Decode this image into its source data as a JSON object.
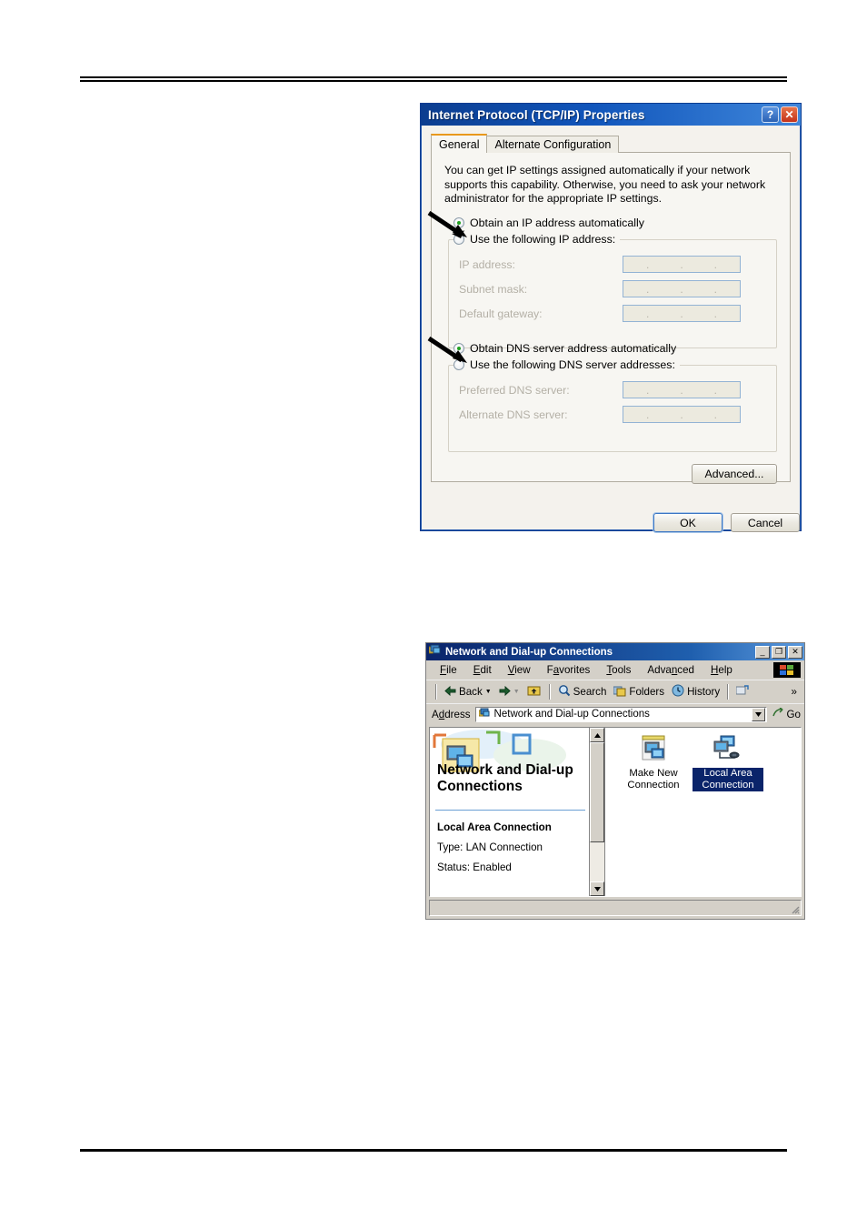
{
  "dialog": {
    "title": "Internet Protocol (TCP/IP) Properties",
    "help_button": "?",
    "close_button": "✕",
    "tabs": [
      {
        "label": "General",
        "active": true
      },
      {
        "label": "Alternate Configuration",
        "active": false
      }
    ],
    "intro": "You can get IP settings assigned automatically if your network supports this capability. Otherwise, you need to ask your network administrator for the appropriate IP settings.",
    "ip_section": {
      "auto_radio_label": "Obtain an IP address automatically",
      "auto_radio_checked": true,
      "manual_radio_label": "Use the following IP address:",
      "manual_radio_checked": false,
      "fields": [
        {
          "label": "IP address:",
          "value": ""
        },
        {
          "label": "Subnet mask:",
          "value": ""
        },
        {
          "label": "Default gateway:",
          "value": ""
        }
      ]
    },
    "dns_section": {
      "auto_radio_label": "Obtain DNS server address automatically",
      "auto_radio_checked": true,
      "manual_radio_label": "Use the following DNS server addresses:",
      "manual_radio_checked": false,
      "fields": [
        {
          "label": "Preferred DNS server:",
          "value": ""
        },
        {
          "label": "Alternate DNS server:",
          "value": ""
        }
      ]
    },
    "advanced_button": "Advanced...",
    "ok_button": "OK",
    "cancel_button": "Cancel",
    "accent_title_color": "#0c3d8f",
    "active_tab_accent": "#e8981c",
    "radio_dot_color": "#21a021"
  },
  "explorer": {
    "title": "Network and Dial-up Connections",
    "minimize_button": "_",
    "maximize_button": "❐",
    "close_button": "✕",
    "menus": [
      {
        "pre": "",
        "accel": "F",
        "post": "ile"
      },
      {
        "pre": "",
        "accel": "E",
        "post": "dit"
      },
      {
        "pre": "",
        "accel": "V",
        "post": "iew"
      },
      {
        "pre": "F",
        "accel": "a",
        "post": "vorites"
      },
      {
        "pre": "",
        "accel": "T",
        "post": "ools"
      },
      {
        "pre": "Adva",
        "accel": "n",
        "post": "ced"
      },
      {
        "pre": "",
        "accel": "H",
        "post": "elp"
      }
    ],
    "toolbar": {
      "back": "Back",
      "forward": "",
      "up": "",
      "search": "Search",
      "folders": "Folders",
      "history": "History",
      "overflow": "»"
    },
    "address": {
      "label_pre": "A",
      "label_accel": "d",
      "label_post": "dress",
      "value": "Network and Dial-up Connections",
      "go_label": "Go"
    },
    "webview": {
      "heading": "Network and Dial-up Connections",
      "selected_name": "Local Area Connection",
      "type_line": "Type: LAN Connection",
      "status_line": "Status: Enabled"
    },
    "items": [
      {
        "label": "Make New Connection",
        "selected": false,
        "icon": "make-new-connection-icon"
      },
      {
        "label": "Local Area Connection",
        "selected": true,
        "icon": "lan-connection-icon"
      }
    ],
    "statusbar_text": "",
    "selection_color": "#0a246a"
  }
}
